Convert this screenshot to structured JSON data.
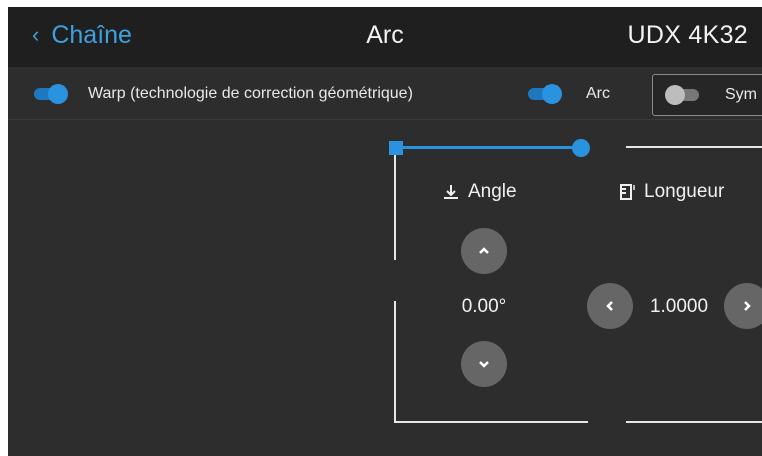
{
  "header": {
    "back_label": "Chaîne",
    "title": "Arc",
    "model": "UDX 4K32"
  },
  "toolbar": {
    "warp": {
      "label": "Warp (technologie de correction géométrique)",
      "enabled": true
    },
    "arc": {
      "label": "Arc",
      "enabled": true
    },
    "symmetry": {
      "label": "Sym",
      "enabled": false
    }
  },
  "panel": {
    "angle": {
      "label": "Angle",
      "value": "0.00°",
      "icon": "angle-icon"
    },
    "length": {
      "label": "Longueur",
      "value": "1.0000",
      "icon": "ruler-icon"
    }
  },
  "colors": {
    "accent": "#2a93df",
    "background": "#2d2d2d",
    "header": "#1f1f1f",
    "button": "#666666"
  }
}
